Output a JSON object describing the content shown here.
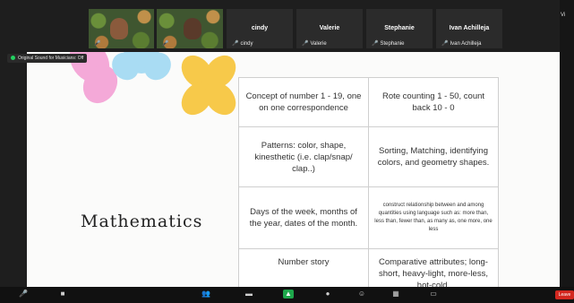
{
  "participants": [
    {
      "name": "",
      "has_video": true
    },
    {
      "name": "",
      "has_video": true
    },
    {
      "name": "cindy",
      "label": "cindy",
      "has_video": false
    },
    {
      "name": "Valerie",
      "label": "Valerie",
      "has_video": false
    },
    {
      "name": "Stephanie",
      "label": "Stephanie",
      "has_video": false
    },
    {
      "name": "Ivan Achilleja",
      "label": "Ivan Achilleja",
      "has_video": false
    }
  ],
  "share_label": "Original Sound for Musicians: Off",
  "right_panel_label": "Vi",
  "slide": {
    "title": "Mathematics",
    "cells": [
      [
        "Concept of number 1 - 19, one on one correspondence",
        "Rote counting 1 - 50, count back 10 - 0"
      ],
      [
        "Patterns: color, shape, kinesthetic (i.e. clap/snap/ clap..)",
        "Sorting, Matching, identifying colors, and geometry shapes."
      ],
      [
        "Days of the week, months of the year, dates of the month.",
        "construct relationship between and among quantities using language such as: more than, less than, fewer than, as many as, one more, one less"
      ],
      [
        "Number story",
        "Comparative attributes; long-short, heavy-light, more-less, hot-cold,"
      ]
    ]
  },
  "toolbar": {
    "end_label": "Leave"
  },
  "colors": {
    "petal_pink": "#f4a9d8",
    "petal_blue": "#a9dcf3",
    "petal_yellow": "#f7c94a",
    "share_green": "#1ea74b",
    "end_red": "#d3271f"
  }
}
